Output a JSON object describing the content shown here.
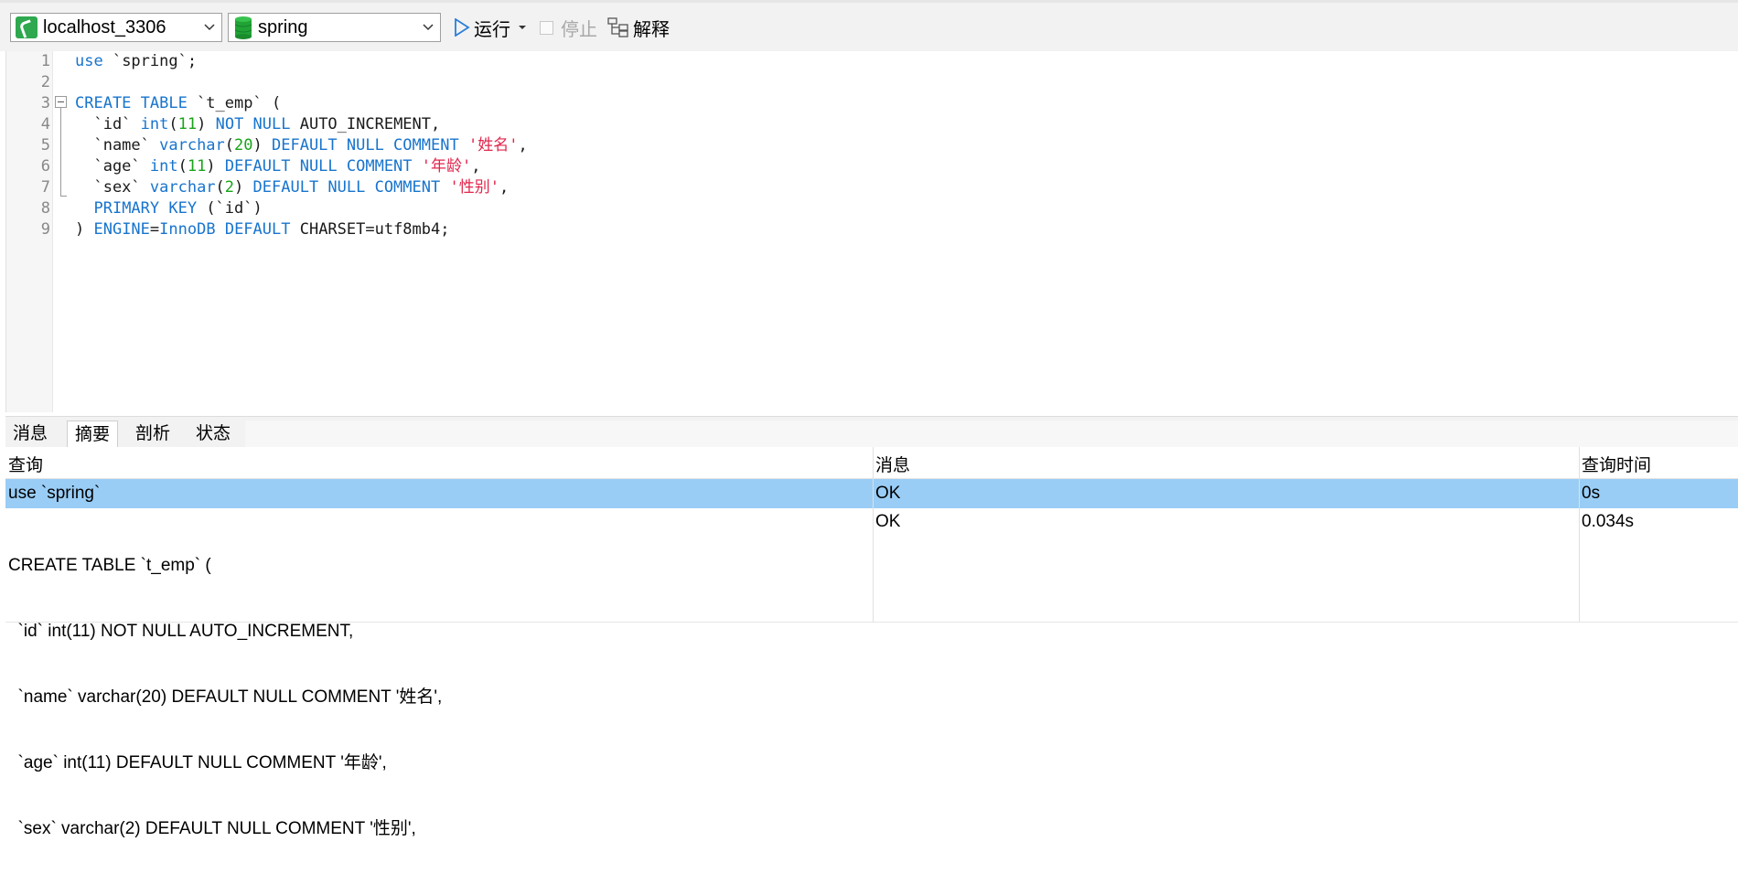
{
  "toolbar": {
    "connection": "localhost_3306",
    "database": "spring",
    "run_label": "运行",
    "stop_label": "停止",
    "explain_label": "解释"
  },
  "editor": {
    "line_numbers": [
      "1",
      "2",
      "3",
      "4",
      "5",
      "6",
      "7",
      "8",
      "9"
    ]
  },
  "tabs": [
    "消息",
    "摘要",
    "剖析",
    "状态"
  ],
  "active_tab": "摘要",
  "results": {
    "headers": [
      "查询",
      "消息",
      "查询时间"
    ],
    "rows": [
      {
        "query": "use `spring`",
        "message": "OK",
        "time": "0s"
      },
      {
        "query_lines": [
          "CREATE TABLE `t_emp` (",
          "  `id` int(11) NOT NULL AUTO_INCREMENT,",
          "  `name` varchar(20) DEFAULT NULL COMMENT '姓名',",
          "  `age` int(11) DEFAULT NULL COMMENT '年龄',",
          "  `sex` varchar(2) DEFAULT NULL COMMENT '性别',"
        ],
        "message": "OK",
        "time": "0.034s"
      }
    ]
  },
  "colors": {
    "keyword": "#1874cd",
    "number": "#19a319",
    "string": "#e0264c",
    "selection": "#99cdf6"
  }
}
